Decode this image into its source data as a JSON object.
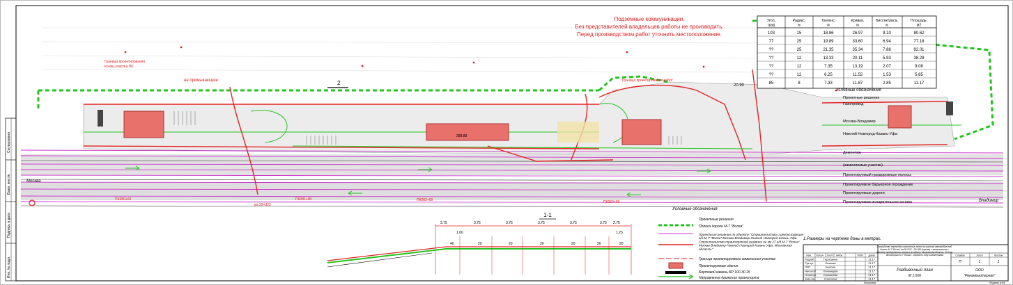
{
  "warning": {
    "line1": "Подземные коммуникации.",
    "line2": "Без представителей владельцев работы не производить.",
    "line3": "Перед производством работ уточнить местоположение."
  },
  "curve_table": {
    "headers": [
      "Угол, град",
      "Радиус, м",
      "Тангенс, м",
      "Кривая, м",
      "Биссектриса, м",
      "Площадь, м2"
    ],
    "rows": [
      [
        "103",
        "15",
        "18.86",
        "26.97",
        "9.10",
        "80.62"
      ],
      [
        "77",
        "25",
        "19.89",
        "33.60",
        "6.94",
        "77.18"
      ],
      [
        "??",
        "25",
        "21.35",
        "35.34",
        "7.88",
        "92.01"
      ],
      [
        "??",
        "12",
        "13.33",
        "20.11",
        "5.93",
        "38.29"
      ],
      [
        "??",
        "12",
        "7.35",
        "13.19",
        "2.07",
        "9.08"
      ],
      [
        "??",
        "12",
        "6.25",
        "11.52",
        "1.53",
        "5.85"
      ],
      [
        "85",
        "8",
        "7.33",
        "11.87",
        "2.85",
        "11.17"
      ]
    ]
  },
  "plan_labels": {
    "section_mark": "2",
    "no_parking": "не примыкающие",
    "boundary_1": "Граница проектирования",
    "boundary_2": "Конец участка ПК",
    "boundary_3": "Граница проектирования работ",
    "dim_1": "20.90",
    "area_1": "288.88",
    "moscow": "Москва",
    "vladimir": "Владимир",
    "pk_1": "км 29+322",
    "pk_2": "ПК280+00",
    "pk_3": "ПК281+00",
    "pk_4": "ПК282+00",
    "pk_5": "ПК283+00"
  },
  "legend_right": {
    "title": "Условные обозначения",
    "items": [
      "Проектные решения",
      "Газопровод",
      "Москва-Владимир",
      "Нижний Новгород-Казань-Уфа",
      "Демонтаж",
      "(заменяемые участки)",
      "Проектируемый придорожные полосы",
      "Проектируемое барьерное ограждение",
      "Проектируемые дороги",
      "Проектируемая испарительная канава"
    ]
  },
  "legend_bottom": {
    "title": "Условные обозначения",
    "items": [
      "Проектные решения",
      "Полоса дороги М-7 \"Волга\"",
      "Проектные решения по объекту \"Строительство и реконструкция а/д М-7 \"Волга\" Москва-Владимир-Нижний Новгород-Казань-Уфа. Строительство транспортной развязки на км 27 а/д М-7 \"Волга\" Москва-Владимир-Нижний Новгород-Казань-Уфа, Московская область\"",
      "Граница проектируемого земельного участка",
      "Проектируемые здания",
      "Бортовой камень БР 100.30.15",
      "Направление движения транспорта"
    ]
  },
  "section": {
    "title": "1-1",
    "dims": [
      "3.75",
      "3.75",
      "3.75",
      "3.75",
      "3.75",
      "3.75",
      "2.75",
      "1.00",
      "1.25"
    ],
    "slopes": [
      "40",
      "20",
      "20",
      "20",
      "20",
      "20",
      "20"
    ]
  },
  "notes": {
    "note1": "1.Размеры на чертеже даны в метрах."
  },
  "title_block": {
    "object_text": "Устройство переходно-скоростных полос на участке автомобильной дороги М-7 \"Волга\" км 29+322 - 29+360 (справа) с примыканием к объекту придорожного сервиса по адресу: Московская область, 29-й км автодороги М-7 \"Волга\", справа по ходу километража",
    "sheet_title": "Разбивочный план",
    "scale": "М 1:500",
    "org_title": "ООО",
    "org_name": "\"Рекомпьютерная\"",
    "stage_head": "Стадия",
    "sheet_head": "Лист",
    "sheets_head": "Листов",
    "stage": "П",
    "sheet": "1",
    "sheets": "1",
    "head_cols": [
      "Изм.",
      "Кол.уч",
      "Лист",
      "№док.",
      "Подп.",
      "Дата"
    ],
    "roles": [
      "Разраб.",
      "Рук.гр.",
      "ГИП",
      "Нач.отд.",
      "Н.контр.",
      "Зам.нач."
    ],
    "names": [
      "Герасимов",
      "Козлова",
      "Быкова",
      "Пономарёв",
      "Соловьёва",
      "Симонова"
    ],
    "dates": [
      "11.17",
      "11.17",
      "11.17",
      "11.17",
      "11.17",
      "11.17"
    ],
    "copied": "Копировал",
    "format": "Формат А4х5"
  },
  "left_stamps": [
    "Взам. инв.№",
    "Подпись и дата",
    "Инв. № подл.",
    "Согласовано"
  ],
  "colors": {
    "green": "#22c41e",
    "red": "#e42222",
    "magenta": "#cc33cc",
    "building": "#e8716b",
    "road": "#c8c8c8"
  }
}
